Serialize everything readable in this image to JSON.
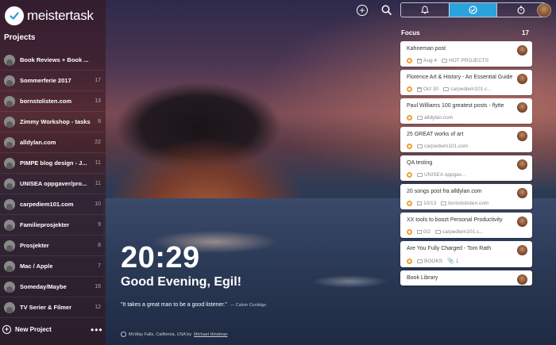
{
  "app": {
    "logo_text": "meistertask"
  },
  "sidebar": {
    "heading": "Projects",
    "projects": [
      {
        "name": "Book Reviews + Book ...",
        "count": ""
      },
      {
        "name": "Sommerferie 2017",
        "count": "17"
      },
      {
        "name": "bornstolisten.com",
        "count": "13"
      },
      {
        "name": "Zimmy Workshop - tasks",
        "count": "8"
      },
      {
        "name": "alldylan.com",
        "count": "22"
      },
      {
        "name": "PIMPE blog design - J...",
        "count": "11"
      },
      {
        "name": "UNISEA oppgaver/pro...",
        "count": "11"
      },
      {
        "name": "carpediem101.com",
        "count": "10"
      },
      {
        "name": "Familieprosjekter",
        "count": "9"
      },
      {
        "name": "Prosjekter",
        "count": "8"
      },
      {
        "name": "Mac / Apple",
        "count": "7"
      },
      {
        "name": "Someday/Maybe",
        "count": "16"
      },
      {
        "name": "TV Serier & Filmer",
        "count": "12"
      }
    ],
    "new_project_label": "New Project",
    "more_label": "•••"
  },
  "topbar": {
    "add_icon": "plus-circle-icon",
    "search_icon": "search-icon",
    "tabs": [
      {
        "icon": "bell-icon",
        "active": false
      },
      {
        "icon": "check-circle-icon",
        "active": true
      },
      {
        "icon": "stopwatch-icon",
        "active": false
      }
    ],
    "accent_color": "#2aa2dc"
  },
  "focus": {
    "title": "Focus",
    "count": "17",
    "tasks": [
      {
        "title": "Kahneman post",
        "meta": [
          {
            "type": "date",
            "text": "Aug 4"
          },
          {
            "type": "project",
            "text": "HOT PROJECTS"
          }
        ]
      },
      {
        "title": "Florence Art & History - An Essential Guide",
        "meta": [
          {
            "type": "date",
            "text": "Oct 30"
          },
          {
            "type": "project",
            "text": "carpediem101.c..."
          }
        ]
      },
      {
        "title": "Paul Williams 100 greatest posts - flytte",
        "meta": [
          {
            "type": "project",
            "text": "alldylan.com"
          }
        ]
      },
      {
        "title": "25 GREAT works of art",
        "meta": [
          {
            "type": "project",
            "text": "carpediem101.com"
          }
        ]
      },
      {
        "title": "QA testing",
        "meta": [
          {
            "type": "project",
            "text": "UNISEA oppgav..."
          }
        ]
      },
      {
        "title": "20 songs post fra alldylan.com",
        "meta": [
          {
            "type": "checklist",
            "text": "10/13"
          },
          {
            "type": "project",
            "text": "bornstolisten.com"
          }
        ]
      },
      {
        "title": "XX tools to boozt Personal Productivity",
        "meta": [
          {
            "type": "checklist",
            "text": "0/2"
          },
          {
            "type": "project",
            "text": "carpediem101.c..."
          }
        ]
      },
      {
        "title": "Are You Fully Charged - Tom Rath",
        "meta": [
          {
            "type": "project",
            "text": "BOOKS"
          },
          {
            "type": "attachment",
            "text": "1"
          }
        ]
      },
      {
        "title": "Book Library",
        "meta": []
      }
    ]
  },
  "hero": {
    "time": "20:29",
    "greeting": "Good Evening, Egil!",
    "quote": "\"It takes a great man to be a good listener.\"",
    "quote_author": "— Calvin Coolidge",
    "photo_location": "McWay Falls, California, USA by",
    "photo_author": "Michael Hindman"
  }
}
